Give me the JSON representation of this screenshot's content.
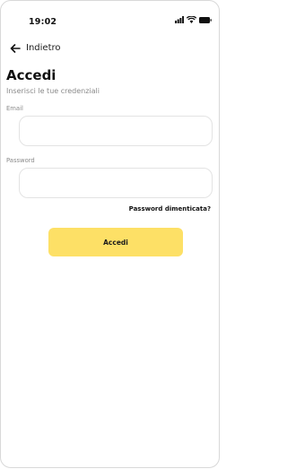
{
  "status_bar": {
    "time": "19:02",
    "icons": [
      "signal-icon",
      "wifi-icon",
      "battery-icon"
    ]
  },
  "nav": {
    "back_label": "Indietro",
    "back_icon": "arrow-left-icon"
  },
  "header": {
    "title": "Accedi",
    "subtitle": "Inserisci le tue credenziali"
  },
  "form": {
    "email_label": "Email",
    "email_value": "",
    "password_label": "Password",
    "password_value": "",
    "forgot_label": "Password dimenticata?",
    "submit_label": "Accedi"
  },
  "colors": {
    "accent": "#fde066",
    "text": "#111111",
    "muted": "#8a8a8a",
    "border": "#e3e3e3"
  }
}
